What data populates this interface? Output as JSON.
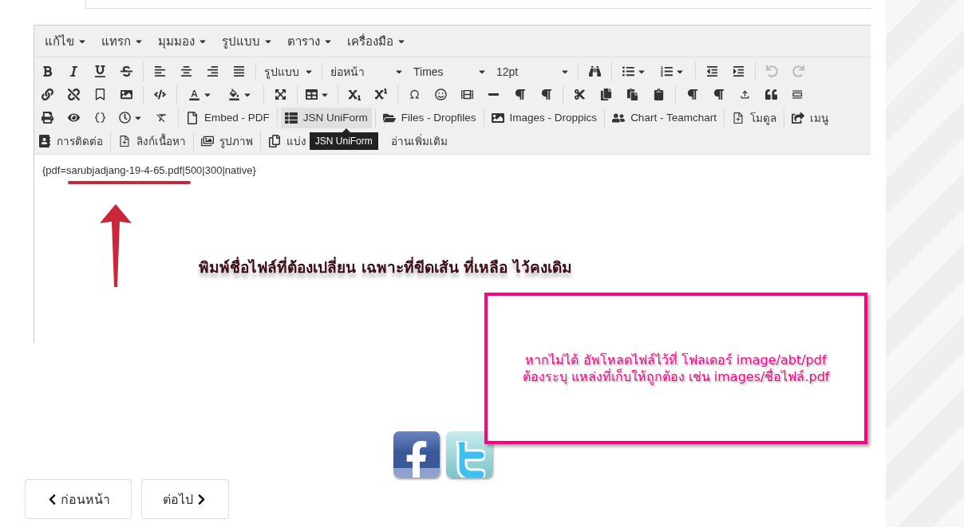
{
  "menubar": [
    {
      "label": "แก้ไข"
    },
    {
      "label": "แทรก"
    },
    {
      "label": "มุมมอง"
    },
    {
      "label": "รูปแบบ"
    },
    {
      "label": "ตาราง"
    },
    {
      "label": "เครื่องมือ"
    }
  ],
  "toolbar": {
    "style_select": "รูปแบบ",
    "block_select": "ย่อหน้า",
    "font_select": "Times",
    "size_select": "12pt",
    "undo": {
      "disabled": true
    },
    "redo": {
      "disabled": true
    },
    "plugin_buttons": [
      {
        "label": "Embed - PDF",
        "hovered": false
      },
      {
        "label": "JSN UniForm",
        "hovered": true
      },
      {
        "label": "Files - Dropfiles",
        "hovered": false
      },
      {
        "label": "Images - Droppics",
        "hovered": false
      },
      {
        "label": "Chart - Teamchart",
        "hovered": false
      },
      {
        "label": "โมดูล",
        "hovered": false
      },
      {
        "label": "เมนู",
        "hovered": false
      }
    ],
    "insert_buttons": [
      {
        "label": "การติดต่อ"
      },
      {
        "label": "ลิงก์เนื้อหา"
      },
      {
        "label": "รูปภาพ"
      },
      {
        "label": "แบ่ง"
      },
      {
        "label": "อ่านเพิ่มเติม"
      }
    ]
  },
  "tooltip": "JSN UniForm",
  "editor_text": "{pdf=sarubjadjang-19-4-65.pdf|500|300|native}",
  "annotation": "พิมพ์ชื่อไฟล์ที่ต้องเปลี่ยน เฉพาะที่ขีดเส้น ที่เหลือ ไว้คงเดิม",
  "note_box": {
    "lines": [
      "หากไม่ได้ อัพโหลดไฟล์ไว้ที่ โฟลเดอร์ image/abt/pdf",
      "ต้องระบุ แหล่งที่เก็บให้ถูกต้อง เช่น images/ชื่อไฟล์.pdf"
    ]
  },
  "pager": [
    {
      "label": "ก่อนหน้า",
      "kind": "prev"
    },
    {
      "label": "ต่อไป",
      "kind": "next"
    }
  ]
}
